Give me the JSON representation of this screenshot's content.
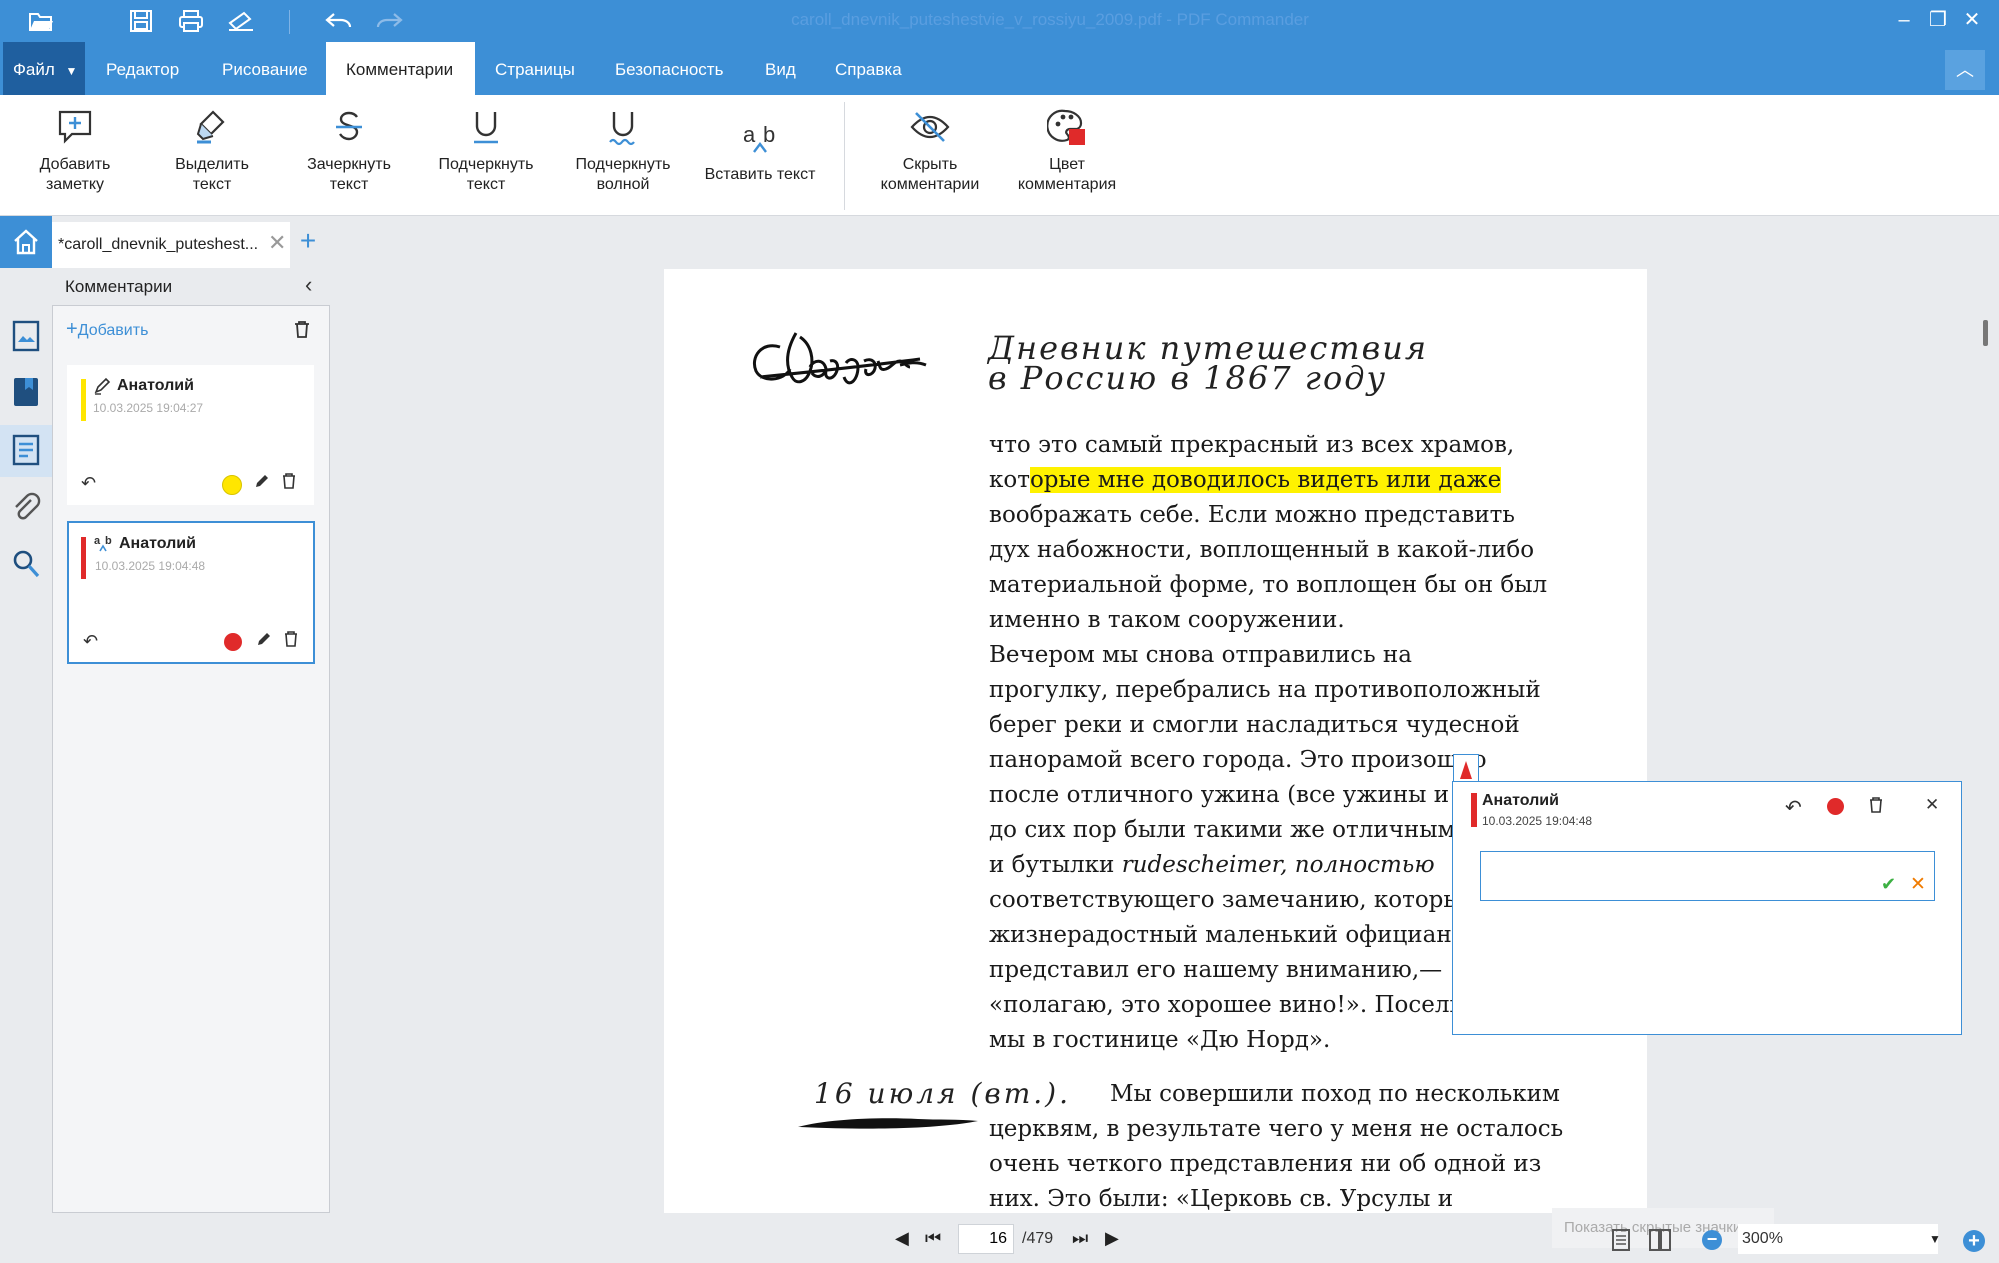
{
  "window": {
    "title": "caroll_dnevnik_puteshestvie_v_rossiyu_2009.pdf - PDF Commander",
    "minimize": "‒",
    "restore": "❐",
    "close": "✕"
  },
  "menu": {
    "file": "Файл",
    "items": [
      "Редактор",
      "Рисование",
      "Комментарии",
      "Страницы",
      "Безопасность",
      "Вид",
      "Справка"
    ],
    "active": "Комментарии"
  },
  "ribbon": {
    "buttons": [
      {
        "label1": "Добавить",
        "label2": "заметку",
        "icon": "add-note-icon"
      },
      {
        "label1": "Выделить",
        "label2": "текст",
        "icon": "highlighter-icon"
      },
      {
        "label1": "Зачеркнуть",
        "label2": "текст",
        "icon": "strikethrough-icon"
      },
      {
        "label1": "Подчеркнуть",
        "label2": "текст",
        "icon": "underline-icon"
      },
      {
        "label1": "Подчеркнуть",
        "label2": "волной",
        "icon": "wavy-underline-icon"
      },
      {
        "label1": "Вставить текст",
        "label2": "",
        "icon": "insert-text-icon"
      },
      {
        "label1": "Скрыть",
        "label2": "комментарии",
        "icon": "hide-eye-icon"
      },
      {
        "label1": "Цвет",
        "label2": "комментария",
        "icon": "color-palette-icon"
      }
    ]
  },
  "tab": {
    "title": "*caroll_dnevnik_puteshest...",
    "close": "✕",
    "new": "+"
  },
  "comments_panel": {
    "title": "Комментарии",
    "collapse": "‹",
    "add_label": "Добавить",
    "cards": [
      {
        "author": "Анатолий",
        "date": "10.03.2025 19:04:27",
        "color": "#ffe600",
        "kind": "highlight"
      },
      {
        "author": "Анатолий",
        "date": "10.03.2025 19:04:48",
        "color": "#e02a2a",
        "kind": "insert-text"
      }
    ]
  },
  "document": {
    "signature": "CLDodgson",
    "heading_line1": "Дневник путешествия",
    "heading_line2": "в Россию в 1867 году",
    "lines": [
      {
        "pre": "что это самый прекрасный из всех храмов,",
        "hl": "",
        "post": ""
      },
      {
        "pre": "кот",
        "hl": "орые мне доводилось видеть или даже",
        "post": ""
      },
      {
        "pre": "воображать себе. Если можно представить",
        "hl": "",
        "post": ""
      },
      {
        "pre": "дух набожности, воплощенный в какой-либо",
        "hl": "",
        "post": ""
      },
      {
        "pre": "материальной форме, то воплощен бы он был",
        "hl": "",
        "post": ""
      },
      {
        "pre": "именно в таком сооружении.",
        "hl": "",
        "post": ""
      },
      {
        "pre": "    Вечером мы снова отправились на",
        "hl": "",
        "post": ""
      },
      {
        "pre": "прогулку, перебрались на противоположный",
        "hl": "",
        "post": ""
      },
      {
        "pre": "берег реки и смогли насладиться чудесной",
        "hl": "",
        "post": ""
      },
      {
        "pre": "панорамой всего города. Это произошло",
        "hl": "",
        "post": ""
      },
      {
        "pre": "после отличного ужина (все ужины и пр",
        "hl": "",
        "post": ""
      },
      {
        "pre": "до сих пор были такими же отличными)",
        "hl": "",
        "post": ""
      },
      {
        "pre": "и бутылки ",
        "hl": "",
        "post": "rudescheimer, полностью"
      },
      {
        "pre": "соответствующего замечанию, которым",
        "hl": "",
        "post": ""
      },
      {
        "pre": "жизнерадостный маленький официант",
        "hl": "",
        "post": ""
      },
      {
        "pre": "представил его нашему вниманию,—",
        "hl": "",
        "post": ""
      },
      {
        "pre": "«полагаю, это хорошее вино!». Поселил",
        "hl": "",
        "post": ""
      },
      {
        "pre": "мы в гостинице «Дю Норд».",
        "hl": "",
        "post": ""
      }
    ],
    "date_note": "16 июля (вт.).",
    "lines2": [
      "Мы совершили поход по нескольким",
      "церквям, в результате чего у меня не осталось",
      "очень четкого представления ни об одной из",
      "них. Это были: «Церковь св. Урсулы и"
    ]
  },
  "popup": {
    "author": "Анатолий",
    "date": "10.03.2025 19:04:48",
    "input_value": ""
  },
  "statusbar": {
    "page": "16",
    "total": "/479",
    "hidden_icons": "Показать скрытые значки",
    "zoom": "300%"
  }
}
